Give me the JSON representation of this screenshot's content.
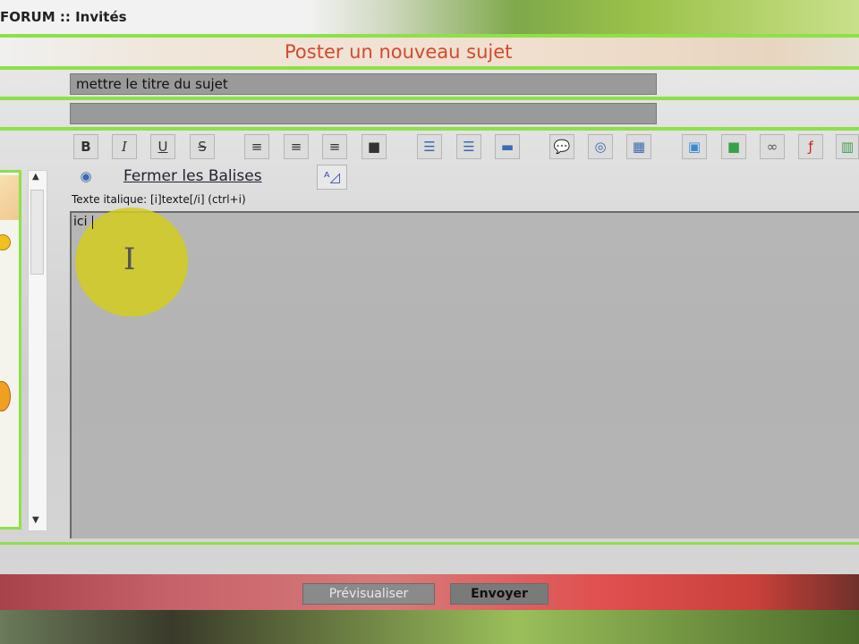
{
  "window": {
    "title": "FORUM :: Invités"
  },
  "page": {
    "title": "Poster un nouveau sujet"
  },
  "form": {
    "subject_value": "mettre le titre du sujet",
    "description_value": "",
    "message_value": "ici"
  },
  "toolbar": {
    "buttons": [
      "B",
      "I",
      "U",
      "S"
    ],
    "close_tags_label": "Fermer les Balises",
    "hint_text": "Texte italique: [i]texte[/i] (ctrl+i)"
  },
  "actions": {
    "preview_label": "Prévisualiser",
    "send_label": "Envoyer"
  },
  "colors": {
    "accent_green": "#8ee04a",
    "title_red": "#d24a2a",
    "highlight_yellow": "#d2cd1e"
  }
}
